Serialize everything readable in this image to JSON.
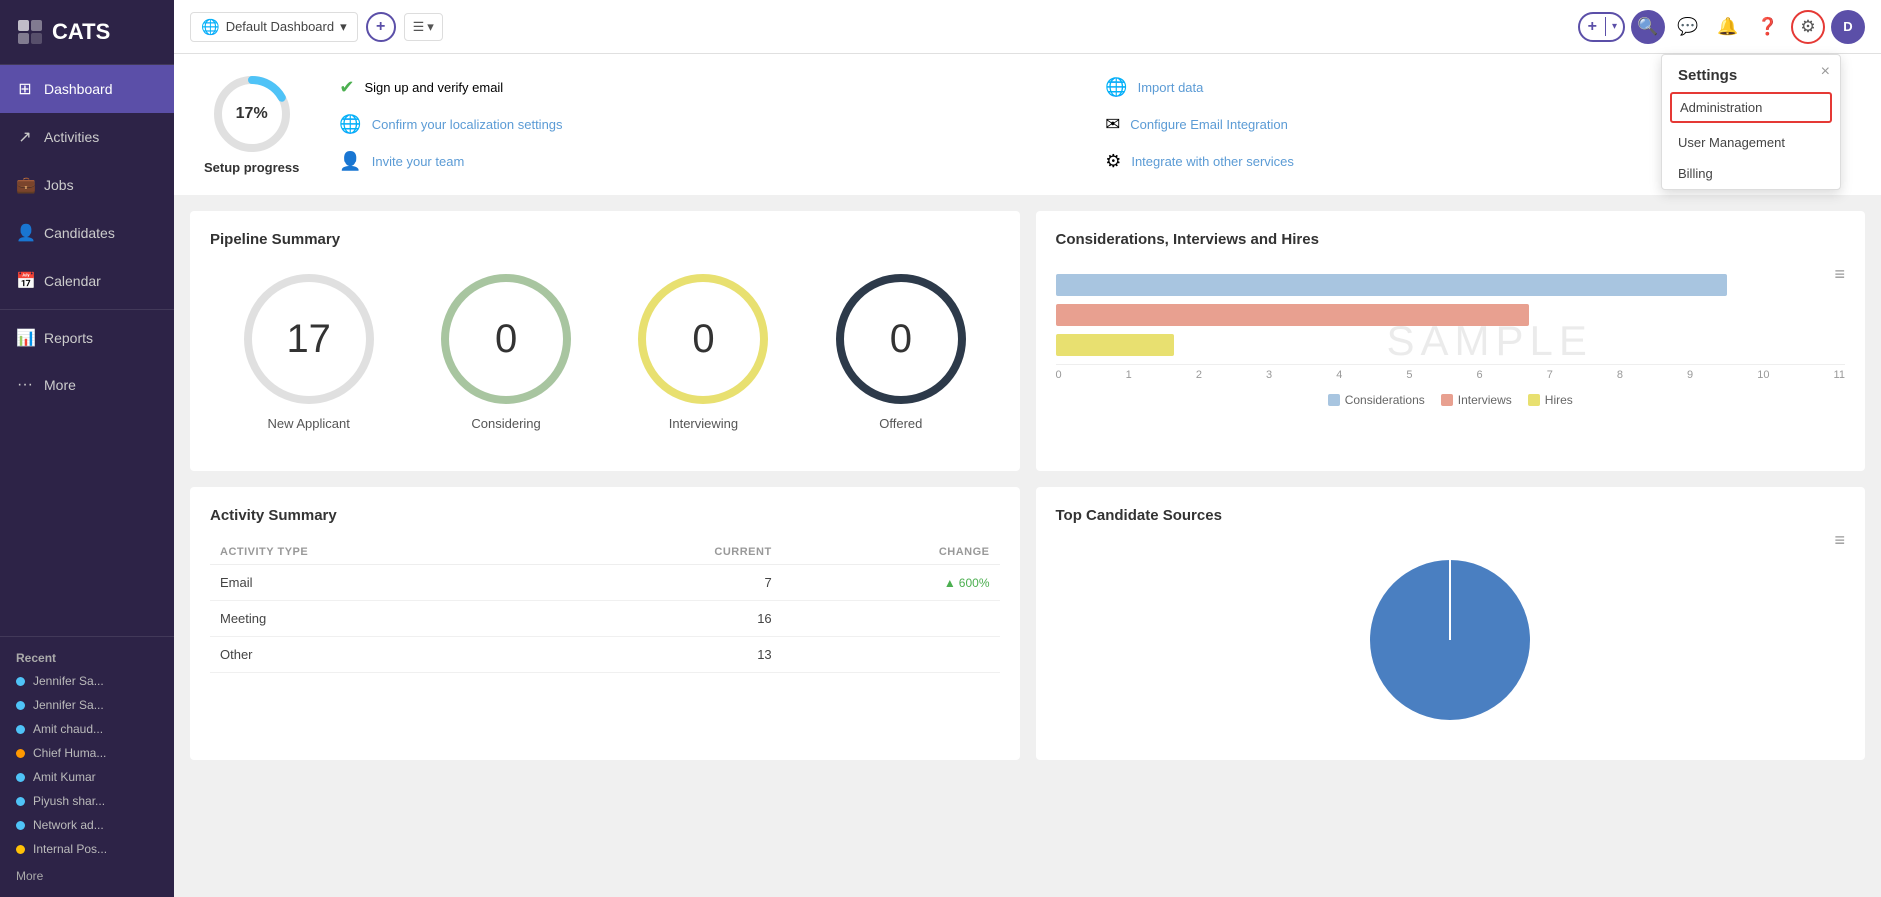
{
  "sidebar": {
    "logo": "CATS",
    "nav_items": [
      {
        "id": "dashboard",
        "label": "Dashboard",
        "icon": "⊞",
        "active": true
      },
      {
        "id": "activities",
        "label": "Activities",
        "icon": "↗"
      },
      {
        "id": "jobs",
        "label": "Jobs",
        "icon": "💼"
      },
      {
        "id": "candidates",
        "label": "Candidates",
        "icon": "👤"
      },
      {
        "id": "calendar",
        "label": "Calendar",
        "icon": "📅"
      },
      {
        "id": "reports",
        "label": "Reports",
        "icon": "📊"
      },
      {
        "id": "more",
        "label": "More",
        "icon": "···"
      }
    ],
    "recent_label": "Recent",
    "recent_items": [
      {
        "label": "Jennifer Sa...",
        "color": "#4fc3f7"
      },
      {
        "label": "Jennifer Sa...",
        "color": "#4fc3f7"
      },
      {
        "label": "Amit chaud...",
        "color": "#4fc3f7"
      },
      {
        "label": "Chief Huma...",
        "color": "#ff9800"
      },
      {
        "label": "Amit Kumar",
        "color": "#4fc3f7"
      },
      {
        "label": "Piyush shar...",
        "color": "#4fc3f7"
      },
      {
        "label": "Network ad...",
        "color": "#4fc3f7"
      },
      {
        "label": "Internal Pos...",
        "color": "#ffc107"
      }
    ],
    "more_link": "More"
  },
  "topbar": {
    "dashboard_label": "Default Dashboard",
    "add_btn_label": "+",
    "settings_label": "Settings",
    "avatar_label": "D"
  },
  "settings_dropdown": {
    "title": "Settings",
    "items": [
      {
        "id": "administration",
        "label": "Administration",
        "highlighted": true
      },
      {
        "id": "user-management",
        "label": "User Management"
      },
      {
        "id": "billing",
        "label": "Billing"
      }
    ],
    "close": "×"
  },
  "setup": {
    "percent": "17%",
    "label": "Setup progress",
    "links_col1": [
      {
        "text": "Sign up and verify email",
        "type": "checked",
        "link": false
      },
      {
        "text": "Confirm your localization settings",
        "type": "globe",
        "link": true
      },
      {
        "text": "Invite your team",
        "type": "person",
        "link": true
      }
    ],
    "links_col2": [
      {
        "text": "Import data",
        "type": "globe",
        "link": true
      },
      {
        "text": "Configure Email Integration",
        "type": "email",
        "link": true
      },
      {
        "text": "Integrate with other services",
        "type": "settings",
        "link": true
      }
    ]
  },
  "pipeline": {
    "title": "Pipeline Summary",
    "items": [
      {
        "value": "17",
        "label": "New Applicant",
        "style": "gray"
      },
      {
        "value": "0",
        "label": "Considering",
        "style": "green"
      },
      {
        "value": "0",
        "label": "Interviewing",
        "style": "yellow"
      },
      {
        "value": "0",
        "label": "Offered",
        "style": "dark"
      }
    ]
  },
  "bar_chart": {
    "title": "Considerations, Interviews and Hires",
    "bars": [
      {
        "label": "",
        "value": 85,
        "max": 100,
        "color": "blue"
      },
      {
        "label": "",
        "value": 60,
        "max": 100,
        "color": "salmon"
      },
      {
        "label": "",
        "value": 15,
        "max": 100,
        "color": "yellow"
      }
    ],
    "axis_labels": [
      "0",
      "1",
      "2",
      "3",
      "4",
      "5",
      "6",
      "7",
      "8",
      "9",
      "10",
      "11"
    ],
    "watermark": "SAMPLE",
    "legend": [
      {
        "label": "Considerations",
        "color": "#a8c5e0"
      },
      {
        "label": "Interviews",
        "color": "#e8a090"
      },
      {
        "label": "Hires",
        "color": "#e8e070"
      }
    ]
  },
  "activity": {
    "title": "Activity Summary",
    "headers": [
      "ACTIVITY TYPE",
      "CURRENT",
      "CHANGE"
    ],
    "rows": [
      {
        "type": "Email",
        "current": "7",
        "change": "600%",
        "change_type": "positive"
      },
      {
        "type": "Meeting",
        "current": "16",
        "change": ""
      },
      {
        "type": "Other",
        "current": "13",
        "change": ""
      }
    ]
  },
  "top_sources": {
    "title": "Top Candidate Sources"
  }
}
